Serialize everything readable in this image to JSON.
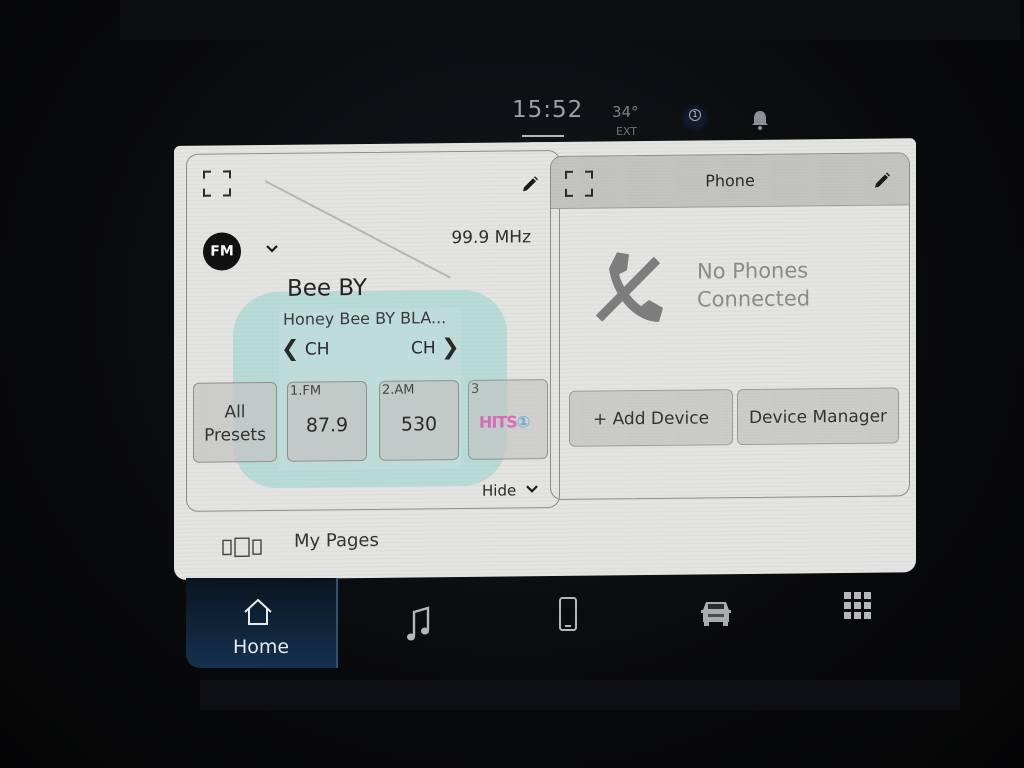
{
  "status_bar": {
    "time": "15:52",
    "temperature": "34°",
    "temperature_label": "EXT",
    "driver_profile": "1"
  },
  "radio_card": {
    "band": "FM",
    "frequency": "99.9 MHz",
    "station_name": "Bee BY",
    "song_title": "Honey Bee BY BLA...",
    "prev_channel_label": "CH",
    "next_channel_label": "CH",
    "all_presets_line1": "All",
    "all_presets_line2": "Presets",
    "presets": [
      {
        "number": "1.FM",
        "value": "87.9"
      },
      {
        "number": "2.AM",
        "value": "530"
      },
      {
        "number": "3",
        "logo": "HITS 1"
      }
    ],
    "hide_label": "Hide"
  },
  "phone_card": {
    "title": "Phone",
    "status_line1": "No Phones",
    "status_line2": "Connected",
    "add_device_label": "+ Add Device",
    "device_manager_label": "Device Manager"
  },
  "my_pages_label": "My Pages",
  "nav": {
    "home_label": "Home",
    "items": [
      "home",
      "media",
      "phone",
      "vehicle",
      "apps"
    ],
    "active": "home"
  }
}
